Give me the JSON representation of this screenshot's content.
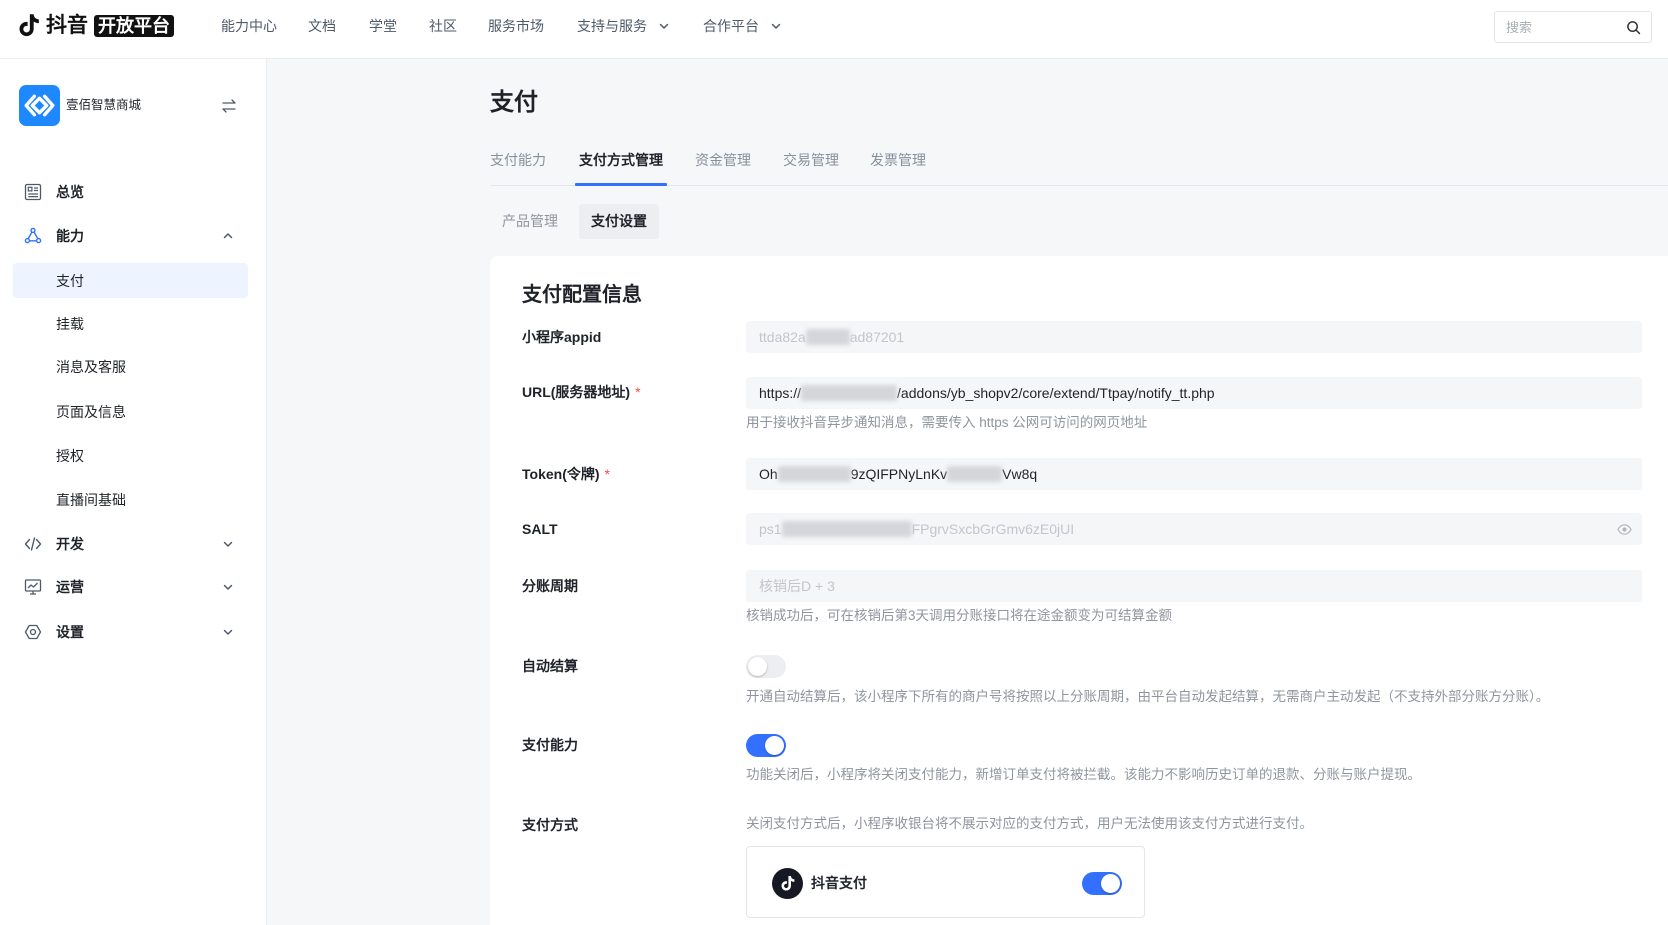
{
  "header": {
    "logo_brand": "抖音",
    "logo_badge": "开放平台",
    "nav": [
      {
        "label": "能力中心"
      },
      {
        "label": "文档"
      },
      {
        "label": "学堂"
      },
      {
        "label": "社区"
      },
      {
        "label": "服务市场"
      },
      {
        "label": "支持与服务",
        "dropdown": true
      },
      {
        "label": "合作平台",
        "dropdown": true
      }
    ],
    "search_placeholder": "搜索"
  },
  "sidebar": {
    "app_name": "壹佰智慧商城",
    "menu": [
      {
        "label": "总览",
        "icon": "overview-icon"
      },
      {
        "label": "能力",
        "icon": "ability-icon",
        "expanded": true,
        "children": [
          {
            "label": "支付",
            "selected": true
          },
          {
            "label": "挂载"
          },
          {
            "label": "消息及客服"
          },
          {
            "label": "页面及信息"
          },
          {
            "label": "授权"
          },
          {
            "label": "直播间基础"
          }
        ]
      },
      {
        "label": "开发",
        "icon": "code-icon",
        "expanded": false
      },
      {
        "label": "运营",
        "icon": "monitor-chart-icon",
        "expanded": false
      },
      {
        "label": "设置",
        "icon": "settings-icon",
        "expanded": false
      }
    ]
  },
  "page": {
    "title": "支付",
    "tabs": [
      {
        "label": "支付能力"
      },
      {
        "label": "支付方式管理",
        "active": true
      },
      {
        "label": "资金管理"
      },
      {
        "label": "交易管理"
      },
      {
        "label": "发票管理"
      }
    ],
    "subtabs": [
      {
        "label": "产品管理"
      },
      {
        "label": "支付设置",
        "active": true
      }
    ],
    "form": {
      "section_title": "支付配置信息",
      "required_mark": "*",
      "appid": {
        "label": "小程序appid",
        "value_parts": [
          "ttda82a",
          "ad87201"
        ]
      },
      "url": {
        "label": "URL(服务器地址)",
        "required": true,
        "value_parts": [
          "https://",
          "/addons/yb_shopv2/core/extend/Ttpay/notify_tt.php"
        ],
        "help": "用于接收抖音异步通知消息，需要传入 https 公网可访问的网页地址"
      },
      "token": {
        "label": "Token(令牌)",
        "required": true,
        "value_parts": [
          "Oh",
          "9zQIFPNyLnKv",
          "Vw8q"
        ]
      },
      "salt": {
        "label": "SALT",
        "value_parts": [
          "ps1",
          "FPgrvSxcbGrGmv6zE0jUI"
        ]
      },
      "settle_cycle": {
        "label": "分账周期",
        "placeholder": "核销后D + 3",
        "help": "核销成功后，可在核销后第3天调用分账接口将在途金额变为可结算金额"
      },
      "auto_settle": {
        "label": "自动结算",
        "enabled": false,
        "help": "开通自动结算后，该小程序下所有的商户号将按照以上分账周期，由平台自动发起结算，无需商户主动发起（不支持外部分账方分账）。"
      },
      "pay_ability": {
        "label": "支付能力",
        "enabled": true,
        "help": "功能关闭后，小程序将关闭支付能力，新增订单支付将被拦截。该能力不影响历史订单的退款、分账与账户提现。"
      },
      "pay_methods": {
        "label": "支付方式",
        "help": "关闭支付方式后，小程序收银台将不展示对应的支付方式，用户无法使用该支付方式进行支付。",
        "items": [
          {
            "name": "抖音支付",
            "icon": "douyin-logo-icon",
            "enabled": true
          }
        ]
      }
    }
  },
  "colors": {
    "accent": "#3370ff",
    "selected_menu_bg": "#edf3ff",
    "required": "#f54a45",
    "help_text": "#8f959e"
  }
}
